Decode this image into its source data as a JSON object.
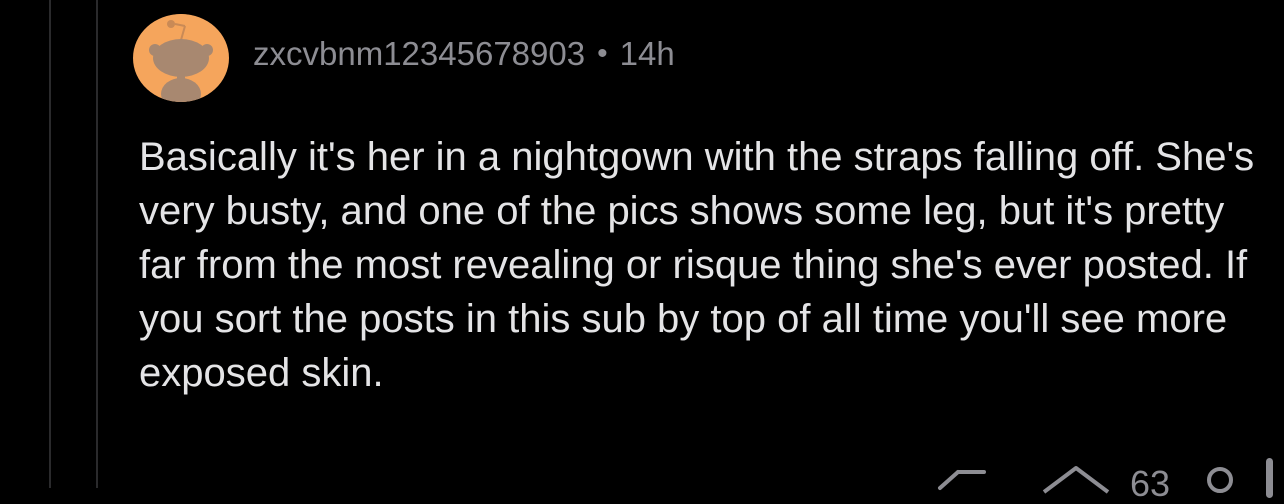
{
  "comment": {
    "username": "zxcvbnm12345678903",
    "separator": "•",
    "age": "14h",
    "body": "Basically it's her in a nightgown with the straps falling off. She's very busty, and one of the pics shows some leg, but it's pretty far from the most revealing or risque thing she's ever posted. If you sort the posts in this sub by top of all time you'll see more exposed skin.",
    "vote_count": "63"
  },
  "colors": {
    "background": "#000000",
    "avatar_background": "#f5a55c",
    "meta_text": "#8d8d93",
    "body_text": "#e4e4e6",
    "thread_line": "#2a2a2c"
  },
  "icons": {
    "avatar": "snoo-avatar-icon",
    "reply": "reply-arrow-icon",
    "upvote": "upvote-arrow-icon",
    "award": "award-icon"
  }
}
